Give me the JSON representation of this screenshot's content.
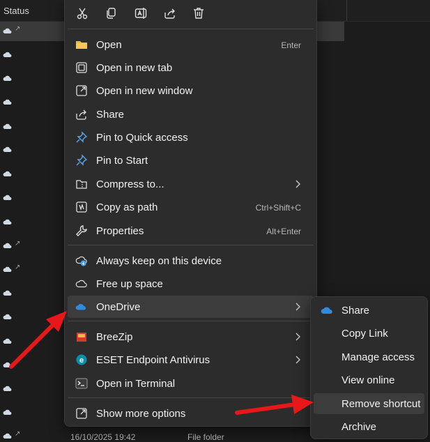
{
  "explorer": {
    "column_status": "Status",
    "row_date": "16/10/2025 19:42",
    "row_type": "File folder",
    "link_symbol": "↗"
  },
  "toolbar": [
    {
      "name": "cut-icon",
      "tooltip": "Cut"
    },
    {
      "name": "copy-icon",
      "tooltip": "Copy"
    },
    {
      "name": "rename-icon",
      "tooltip": "Rename"
    },
    {
      "name": "share-icon",
      "tooltip": "Share"
    },
    {
      "name": "delete-icon",
      "tooltip": "Delete"
    }
  ],
  "menu": {
    "open": {
      "label": "Open",
      "shortcut": "Enter"
    },
    "open_new_tab": {
      "label": "Open in new tab"
    },
    "open_new_window": {
      "label": "Open in new window"
    },
    "share": {
      "label": "Share"
    },
    "pin_quick": {
      "label": "Pin to Quick access"
    },
    "pin_start": {
      "label": "Pin to Start"
    },
    "compress": {
      "label": "Compress to..."
    },
    "copy_path": {
      "label": "Copy as path",
      "shortcut": "Ctrl+Shift+C"
    },
    "properties": {
      "label": "Properties",
      "shortcut": "Alt+Enter"
    },
    "keep_device": {
      "label": "Always keep on this device"
    },
    "free_space": {
      "label": "Free up space"
    },
    "onedrive": {
      "label": "OneDrive"
    },
    "breezip": {
      "label": "BreeZip"
    },
    "eset": {
      "label": "ESET Endpoint Antivirus"
    },
    "terminal": {
      "label": "Open in Terminal"
    },
    "more_options": {
      "label": "Show more options"
    }
  },
  "submenu": {
    "share": "Share",
    "copy_link": "Copy Link",
    "manage_access": "Manage access",
    "view_online": "View online",
    "remove_shortcut": "Remove shortcut",
    "archive": "Archive"
  },
  "colors": {
    "menu_bg": "#2c2c2c",
    "highlight": "#3c3c3c",
    "accent_blue": "#4aa3e8",
    "arrow_red": "#e8171a"
  }
}
